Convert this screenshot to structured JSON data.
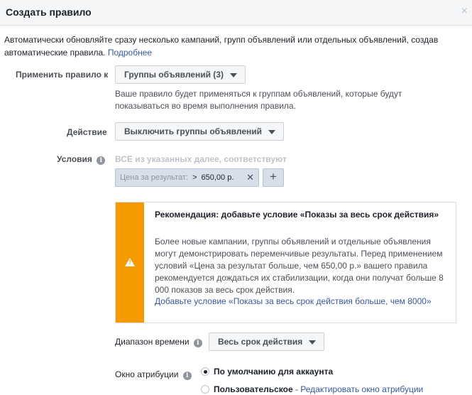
{
  "dialog": {
    "title": "Создать правило",
    "close_glyph": "×"
  },
  "intro": {
    "text": "Автоматически обновляйте сразу несколько кампаний, групп объявлений или отдельных объявлений, создав автоматические правила.",
    "link": "Подробнее"
  },
  "apply_rule": {
    "label": "Применить правило к",
    "value": "Группы объявлений (3)",
    "help": "Ваше правило будет применяться к группам объявлений, которые будут показываться во время выполнения правила."
  },
  "action": {
    "label": "Действие",
    "value": "Выключить группы объявлений"
  },
  "conditions": {
    "label": "Условия",
    "hint": "ВСЕ из указанных далее, соответствуют",
    "token": {
      "field": "Цена за результат:",
      "operator": ">",
      "value": "650,00 р."
    },
    "add_glyph": "+"
  },
  "recommendation": {
    "accent_color": "#f59b00",
    "title": "Рекомендация: добавьте условие «Показы за весь срок действия»",
    "body": "Более новые кампании, группы объявлений и отдельные объявления могут демонстрировать переменчивые результаты. Перед применением условий «Цена за результат больше, чем 650,00 р.» вашего правила рекомендуется дождаться их стабилизации, когда они получат больше 8 000 показов за весь срок действия.",
    "link": "Добавьте условие «Показы за весь срок действия больше, чем 8000»"
  },
  "time_range": {
    "label": "Диапазон времени",
    "value": "Весь срок действия"
  },
  "attribution": {
    "label": "Окно атрибуции",
    "options": [
      {
        "label": "По умолчанию для аккаунта",
        "checked": true
      },
      {
        "label": "Пользовательское",
        "separator": " - ",
        "extra": "Редактировать окно атрибуции",
        "checked": false
      }
    ]
  }
}
